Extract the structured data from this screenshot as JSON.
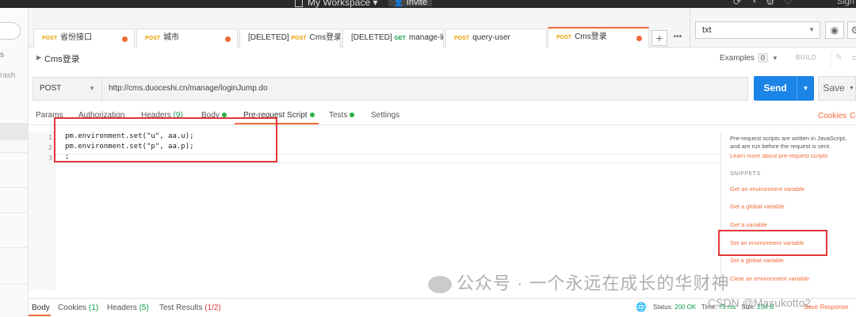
{
  "topbar": {
    "workspace": "My Workspace",
    "invite": "Invite",
    "signin": "Sign In"
  },
  "sidebar": {
    "item_s": "s",
    "trash": "rash"
  },
  "tabs": [
    {
      "method": "POST",
      "name": "省份接口",
      "dot": true,
      "deleted": false
    },
    {
      "method": "POST",
      "name": "城市",
      "dot": true,
      "deleted": false
    },
    {
      "method": "POST",
      "name": "Cms登录",
      "dot": false,
      "deleted": true,
      "prefix": "[DELETED]"
    },
    {
      "method": "GET",
      "name": "manage-list",
      "dot": false,
      "deleted": true,
      "prefix": "[DELETED]"
    },
    {
      "method": "POST",
      "name": "query-user",
      "dot": false,
      "deleted": false
    },
    {
      "method": "POST",
      "name": "Cms登录",
      "dot": true,
      "deleted": false,
      "active": true
    }
  ],
  "tabstrip": {
    "plus": "+",
    "more": "•••"
  },
  "environment": {
    "selected": "txt"
  },
  "request": {
    "name": "Cms登录",
    "examples_label": "Examples",
    "examples_count": "0",
    "build": "BUILD",
    "method": "POST",
    "url": "http://cms.duoceshi.cn/manage/loginJump.do",
    "send": "Send",
    "save": "Save"
  },
  "subtabs": {
    "params": "Params",
    "authorization": "Authorization",
    "headers": "Headers",
    "headers_count": "(9)",
    "body": "Body",
    "prerequest": "Pre-request Script",
    "tests": "Tests",
    "settings": "Settings",
    "cookies": "Cookies",
    "code": "Code"
  },
  "editor": {
    "lines": [
      {
        "n": "1",
        "code": "pm.environment.set(\"u\", aa.u);"
      },
      {
        "n": "2",
        "code": "pm.environment.set(\"p\", aa.p);"
      },
      {
        "n": "3",
        "code": ";"
      }
    ]
  },
  "snippets": {
    "description": "Pre-request scripts are written in JavaScript, and are run before the request is sent.",
    "learn_more": "Learn more about pre-request scripts",
    "heading": "SNIPPETS",
    "items": [
      "Get an environment variable",
      "Get a global variable",
      "Get a variable",
      "Set an environment variable",
      "Set a global variable",
      "Clear an environment variable"
    ]
  },
  "watermark": {
    "main": "公众号 · 一个永远在成长的华财神",
    "csdn": "CSDN @Masukotto2"
  },
  "response": {
    "body": "Body",
    "cookies": "Cookies",
    "cookies_count": "(1)",
    "headers": "Headers",
    "headers_count": "(5)",
    "test_results": "Test Results",
    "test_count": "(1/2)",
    "status_label": "Status:",
    "status_value": "200 OK",
    "time_label": "Time:",
    "time_value": "75 ms",
    "size_label": "Size:",
    "size_value": "234 B",
    "save_response": "Save Response"
  },
  "colors": {
    "accent": "#f26b3a",
    "send": "#1b84e7",
    "annotation": "#e0363a",
    "success": "#0f9b4c"
  }
}
